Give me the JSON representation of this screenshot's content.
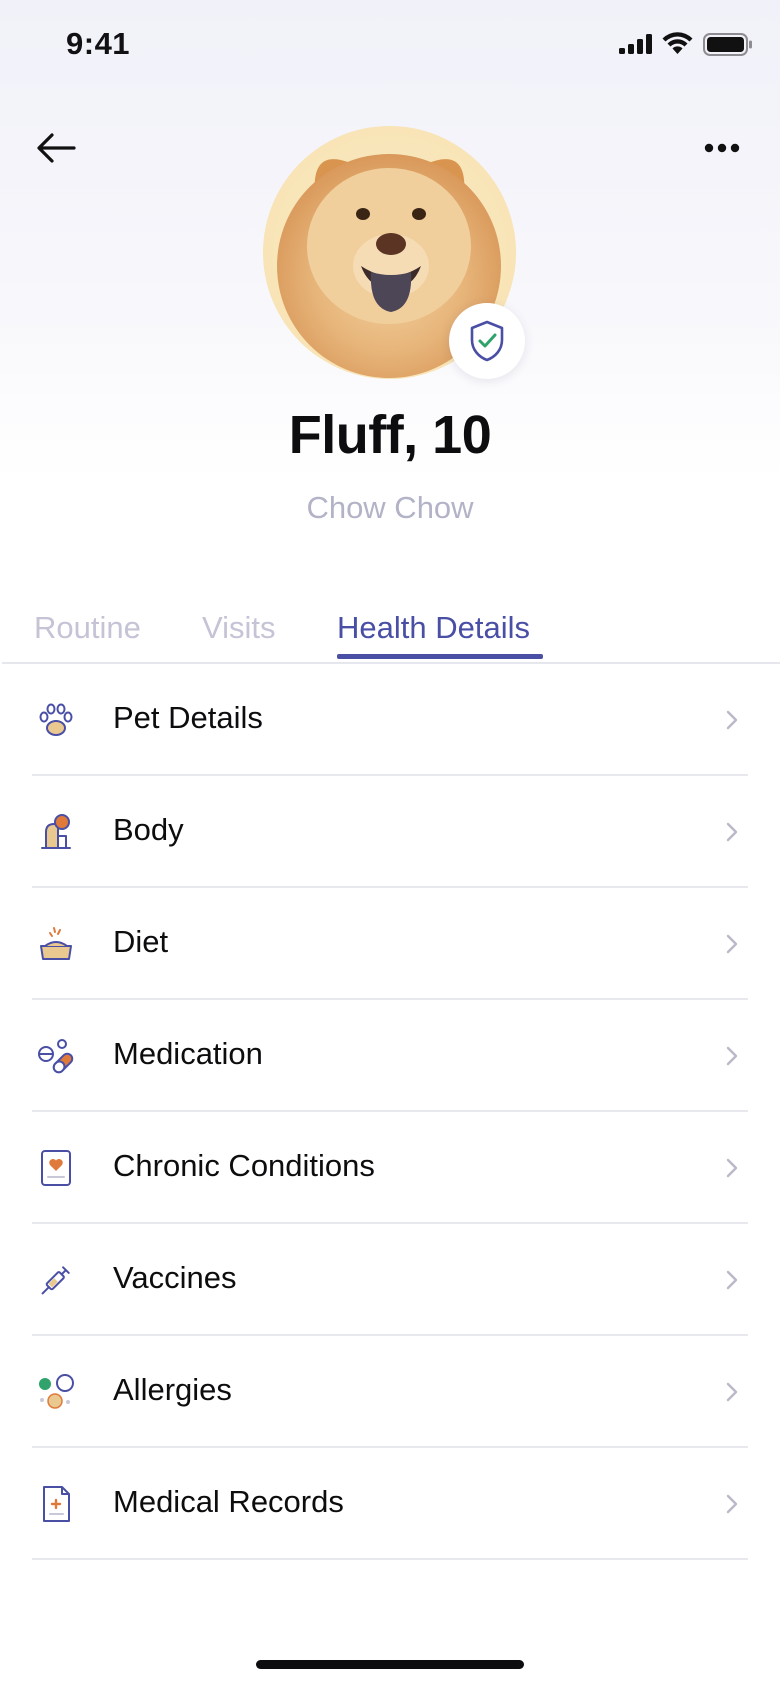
{
  "status_bar": {
    "time": "9:41"
  },
  "profile": {
    "name": "Fluff, 10",
    "breed": "Chow Chow"
  },
  "tabs": [
    {
      "label": "Routine",
      "active": false
    },
    {
      "label": "Visits",
      "active": false
    },
    {
      "label": "Health Details",
      "active": true
    }
  ],
  "health_items": [
    {
      "label": "Pet Details",
      "icon": "paw-icon"
    },
    {
      "label": "Body",
      "icon": "dog-body-icon"
    },
    {
      "label": "Diet",
      "icon": "food-bowl-icon"
    },
    {
      "label": "Medication",
      "icon": "pills-icon"
    },
    {
      "label": "Chronic Conditions",
      "icon": "heart-chart-icon"
    },
    {
      "label": "Vaccines",
      "icon": "syringe-icon"
    },
    {
      "label": "Allergies",
      "icon": "allergen-icon"
    },
    {
      "label": "Medical Records",
      "icon": "medical-document-icon"
    }
  ],
  "colors": {
    "accent": "#4a4fa6",
    "inactive_tab": "#c4c4d6",
    "breed_text": "#b3b3c7",
    "icon_orange": "#e07a3a",
    "icon_tan": "#e9c98f",
    "icon_green": "#2fa36b"
  }
}
